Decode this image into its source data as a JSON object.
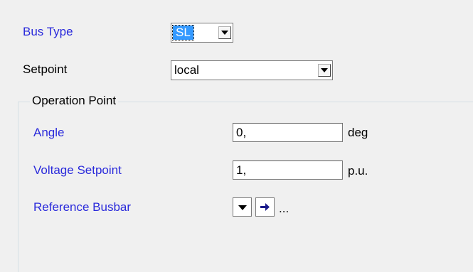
{
  "bus_type": {
    "label": "Bus Type",
    "value": "SL"
  },
  "setpoint": {
    "label": "Setpoint",
    "value": "local"
  },
  "operation_point": {
    "title": "Operation Point",
    "angle": {
      "label": "Angle",
      "value": "0,",
      "unit": "deg"
    },
    "voltage_setpoint": {
      "label": "Voltage Setpoint",
      "value": "1,",
      "unit": "p.u."
    },
    "reference_busbar": {
      "label": "Reference Busbar",
      "ellipsis": "..."
    }
  },
  "colors": {
    "label_blue": "#2a2adb",
    "selection": "#3399ff",
    "background": "#f0f0f0"
  },
  "icons": [
    "chevron-down-icon",
    "arrow-right-icon"
  ]
}
